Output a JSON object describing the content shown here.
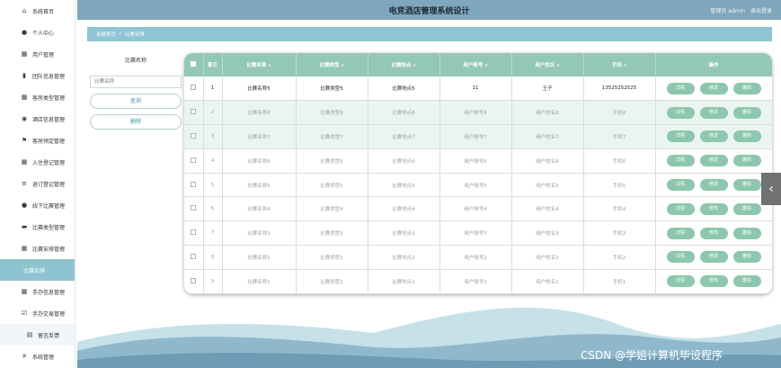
{
  "app": {
    "title": "电竞酒店管理系统设计",
    "user_label": "管理员 admin",
    "logout_label": "退出登录"
  },
  "sidebar": {
    "items": [
      {
        "icon": "home-icon",
        "glyph": "⌂",
        "label": "系统首页"
      },
      {
        "icon": "user-icon",
        "glyph": "●",
        "label": "个人中心"
      },
      {
        "icon": "grid-icon",
        "glyph": "▦",
        "label": "用户管理"
      },
      {
        "icon": "bar-chart-icon",
        "glyph": "▮",
        "label": "团队信息管理"
      },
      {
        "icon": "grid-icon",
        "glyph": "▦",
        "label": "客房类型管理"
      },
      {
        "icon": "location-icon",
        "glyph": "◉",
        "label": "酒店信息管理"
      },
      {
        "icon": "flag-icon",
        "glyph": "⚑",
        "label": "客房预定管理"
      },
      {
        "icon": "grid-icon",
        "glyph": "▦",
        "label": "入住登记管理"
      },
      {
        "icon": "list-icon",
        "glyph": "≡",
        "label": "退订登记管理"
      },
      {
        "icon": "user-icon",
        "glyph": "●",
        "label": "线下比赛管理"
      },
      {
        "icon": "briefcase-icon",
        "glyph": "▬",
        "label": "比赛类型管理"
      },
      {
        "icon": "grid-icon",
        "glyph": "▦",
        "label": "比赛安排管理"
      },
      {
        "icon": "",
        "glyph": "",
        "label": "比赛安排",
        "active": true
      },
      {
        "icon": "grid-icon",
        "glyph": "▦",
        "label": "手办信息管理"
      },
      {
        "icon": "checkbox-icon",
        "glyph": "☑",
        "label": "手办交易管理"
      },
      {
        "icon": "grid-icon",
        "glyph": "▤",
        "label": "留言反馈",
        "sub": true
      },
      {
        "icon": "settings-icon",
        "glyph": "✕",
        "label": "系统管理"
      }
    ]
  },
  "breadcrumb": {
    "home": "系统首页",
    "separator": "/",
    "current": "比赛安排"
  },
  "filter": {
    "label": "比赛名称",
    "placeholder": "比赛名称",
    "search_label": "查询",
    "delete_label": "删除"
  },
  "table": {
    "headers": [
      "索引",
      "比赛名称",
      "比赛类型",
      "比赛地点",
      "用户账号",
      "用户姓名",
      "手机",
      "操作"
    ],
    "rows": [
      {
        "index": "1",
        "name": "比赛名称5",
        "type": "比赛类型5",
        "place": "比赛地点5",
        "account": "11",
        "uname": "王子",
        "phone": "13525252525"
      },
      {
        "index": "2",
        "name": "比赛名称8",
        "type": "比赛类型8",
        "place": "比赛地点8",
        "account": "用户账号8",
        "uname": "用户姓名8",
        "phone": "手机8"
      },
      {
        "index": "3",
        "name": "比赛名称7",
        "type": "比赛类型7",
        "place": "比赛地点7",
        "account": "用户账号7",
        "uname": "用户姓名7",
        "phone": "手机7"
      },
      {
        "index": "4",
        "name": "比赛名称6",
        "type": "比赛类型6",
        "place": "比赛地点6",
        "account": "用户账号6",
        "uname": "用户姓名6",
        "phone": "手机6"
      },
      {
        "index": "5",
        "name": "比赛名称5",
        "type": "比赛类型5",
        "place": "比赛地点5",
        "account": "用户账号5",
        "uname": "用户姓名5",
        "phone": "手机5"
      },
      {
        "index": "6",
        "name": "比赛名称4",
        "type": "比赛类型4",
        "place": "比赛地点4",
        "account": "用户账号4",
        "uname": "用户姓名4",
        "phone": "手机4"
      },
      {
        "index": "7",
        "name": "比赛名称3",
        "type": "比赛类型3",
        "place": "比赛地点3",
        "account": "用户账号3",
        "uname": "用户姓名3",
        "phone": "手机3"
      },
      {
        "index": "8",
        "name": "比赛名称2",
        "type": "比赛类型2",
        "place": "比赛地点2",
        "account": "用户账号2",
        "uname": "用户姓名2",
        "phone": "手机2"
      },
      {
        "index": "9",
        "name": "比赛名称1",
        "type": "比赛类型1",
        "place": "比赛地点1",
        "account": "用户账号1",
        "uname": "用户姓名1",
        "phone": "手机1"
      }
    ],
    "actions": {
      "detail": "详情",
      "edit": "修改",
      "delete": "删除"
    }
  },
  "watermark": "CSDN @学姐计算机毕设程序",
  "colors": {
    "accent": "#8ec4d4",
    "header_teal": "#93c7b6",
    "action_button": "#8cc7ae",
    "topbar": "#7fa6bd"
  }
}
